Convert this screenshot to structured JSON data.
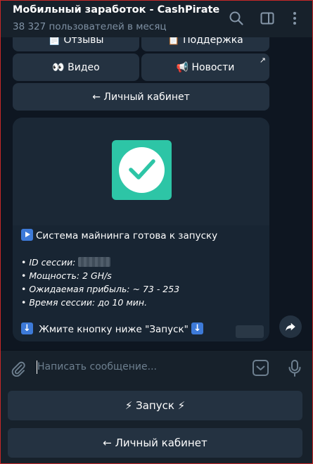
{
  "header": {
    "title": "Мобильный заработок - CashPirate",
    "subtitle": "38 327 пользователей в месяц",
    "icons": [
      "search-icon",
      "sidebar-toggle-icon",
      "more-vert-icon"
    ]
  },
  "inline_keyboard": {
    "top_left_partial": "📄 Отзывы",
    "top_right_partial": "📋 Поддержка",
    "video": "👀 Видео",
    "news": "📢 Новости",
    "news_corner": "↗",
    "cabinet": "← Личный кабинет"
  },
  "message": {
    "media_icon": "check-mark-icon",
    "title_line": "Система майнинга готова к запуску",
    "session_id_label": "• ID сессии:",
    "power": "• Мощность: 2 GH/s",
    "profit": "• Ожидаемая прибыль: ~ 73 - 253",
    "time": "• Время сессии: до 10 мин.",
    "cta": " Жмите кнопку ниже \"Запуск\" "
  },
  "input": {
    "placeholder": "Написать сообщение..."
  },
  "reply_keyboard": {
    "launch": "⚡ Запуск ⚡",
    "cabinet": "← Личный кабинет"
  },
  "colors": {
    "background": "#0e1621",
    "panel": "#17212b",
    "button": "#243241",
    "bubble": "#182533",
    "accent_green": "#2dc5a6",
    "muted_text": "#7f91a4"
  }
}
